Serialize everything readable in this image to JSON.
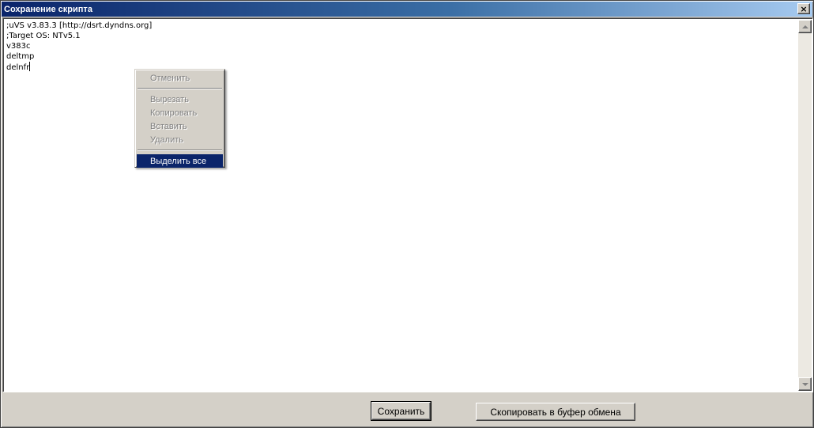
{
  "window": {
    "title": "Сохранение скрипта",
    "close_label": "×"
  },
  "editor": {
    "lines": [
      ";uVS v3.83.3 [http://dsrt.dyndns.org]",
      ";Target OS: NTv5.1",
      "v383c",
      "deltmp",
      "delnfr"
    ]
  },
  "context_menu": {
    "items": [
      {
        "label": "Отменить",
        "enabled": false
      },
      {
        "label": "Вырезать",
        "enabled": false
      },
      {
        "label": "Копировать",
        "enabled": false
      },
      {
        "label": "Вставить",
        "enabled": false
      },
      {
        "label": "Удалить",
        "enabled": false
      },
      {
        "label": "Выделить все",
        "enabled": true,
        "selected": true
      }
    ]
  },
  "buttons": {
    "save_label": "Сохранить",
    "copy_label": "Скопировать в буфер обмена"
  },
  "icons": {
    "close": "close-icon",
    "scroll_up": "scroll-up-arrow-icon",
    "scroll_down": "scroll-down-arrow-icon"
  },
  "colors": {
    "title_gradient_start": "#0a246a",
    "title_gradient_end": "#a6caf0",
    "menu_highlight": "#0a246a",
    "face": "#d4d0c8"
  }
}
